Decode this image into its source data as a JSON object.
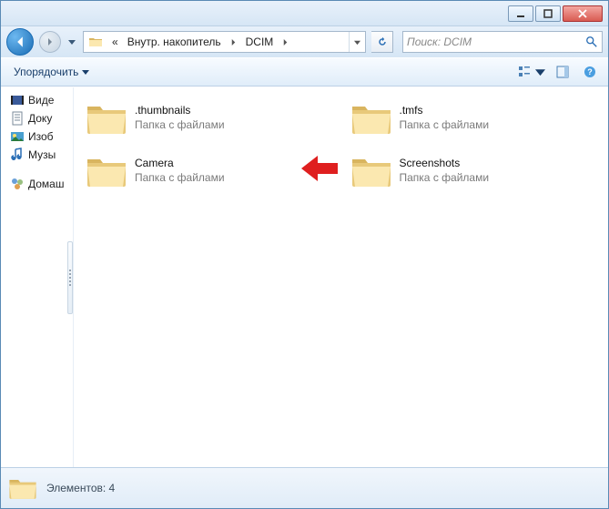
{
  "titlebar": {
    "minimize": "minimize",
    "maximize": "maximize",
    "close": "close"
  },
  "address": {
    "segments": [
      "Внутр. накопитель",
      "DCIM"
    ],
    "prefix_chevron": "«"
  },
  "search": {
    "placeholder": "Поиск: DCIM"
  },
  "toolbar": {
    "organize_label": "Упорядочить"
  },
  "sidebar": {
    "items": [
      {
        "label": "Виде",
        "icon": "film"
      },
      {
        "label": "Доку",
        "icon": "doc"
      },
      {
        "label": "Изоб",
        "icon": "pic"
      },
      {
        "label": "Музы",
        "icon": "music"
      }
    ],
    "homegroup_label": "Домаш"
  },
  "folders": [
    {
      "name": ".thumbnails",
      "sub": "Папка с файлами"
    },
    {
      "name": ".tmfs",
      "sub": "Папка с файлами"
    },
    {
      "name": "Camera",
      "sub": "Папка с файлами"
    },
    {
      "name": "Screenshots",
      "sub": "Папка с файлами"
    }
  ],
  "status": {
    "text": "Элементов: 4"
  }
}
